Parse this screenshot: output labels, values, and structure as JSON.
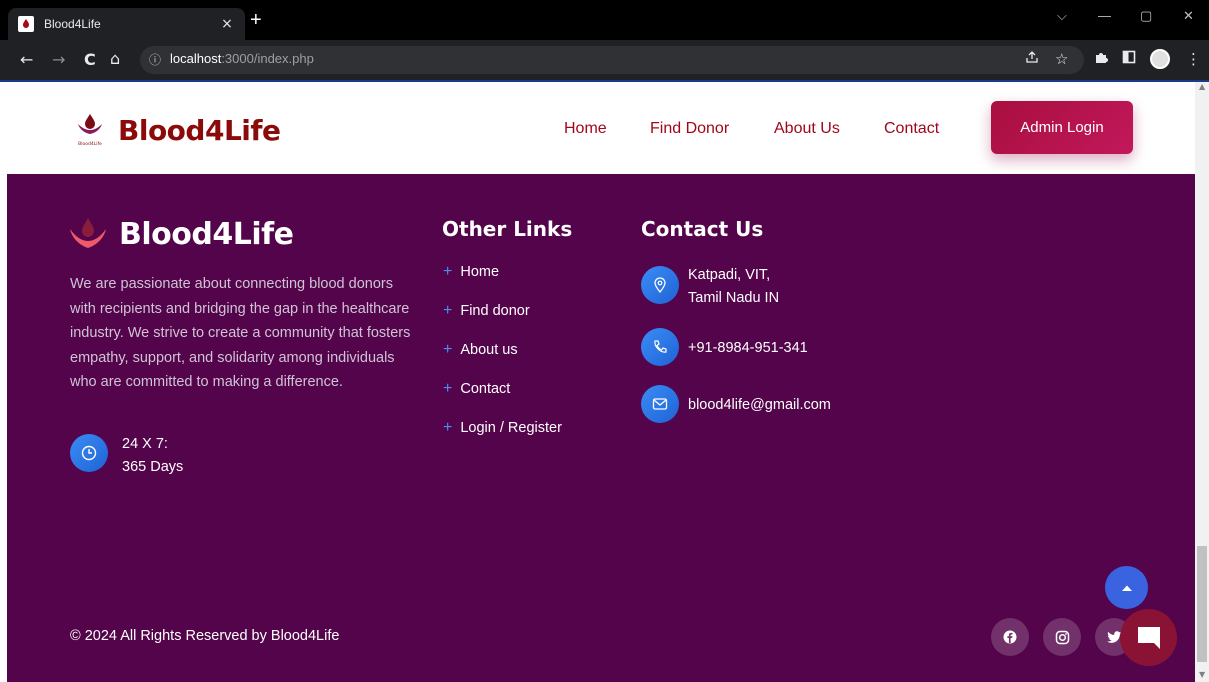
{
  "browser": {
    "tab_title": "Blood4Life",
    "tab_close": "×",
    "new_tab": "+",
    "url_host": "localhost",
    "url_rest": ":3000/index.php",
    "nav_back": "←",
    "nav_forward": "→",
    "nav_reload": "C",
    "nav_home": "⌂",
    "info_icon": "ⓘ",
    "win_dropdown": "⌵",
    "win_minimize": "—",
    "win_restore": "▢",
    "win_close": "✕"
  },
  "header": {
    "brand": "Blood4Life",
    "logo_small_text": "Blood4Life",
    "nav": [
      "Home",
      "Find Donor",
      "About Us",
      "Contact"
    ],
    "admin_login": "Admin Login"
  },
  "footer": {
    "brand": "Blood4Life",
    "about": "We are passionate about connecting blood donors with recipients and bridging the gap in the healthcare industry. We strive to create a community that fosters empathy, support, and solidarity among individuals who are committed to making a difference.",
    "hours_line1": "24 X 7:",
    "hours_line2": "365 Days",
    "other_links_title": "Other Links",
    "other_links": [
      "Home",
      "Find donor",
      "About us",
      "Contact",
      "Login / Register"
    ],
    "plus": "+",
    "contact_title": "Contact Us",
    "address_line1": "Katpadi, VIT,",
    "address_line2": "Tamil Nadu IN",
    "phone": "+91-8984-951-341",
    "email": "blood4life@gmail.com",
    "copyright": "© 2024 All Rights Reserved by Blood4Life"
  },
  "icons": {
    "clock": "clock-icon",
    "location": "location-pin-icon",
    "phone": "phone-icon",
    "email": "mail-icon",
    "facebook": "facebook-icon",
    "instagram": "instagram-icon",
    "twitter": "twitter-icon",
    "back_to_top": "arrow-up-icon",
    "chat": "chat-icon"
  },
  "colors": {
    "brand_red": "#8b0a0a",
    "nav_red": "#a0071c",
    "admin_button": "#c2185b",
    "footer_bg": "#54044a",
    "icon_blue": "#1e63d6",
    "back_to_top_blue": "#3a63e0",
    "chat_button": "#8a1234"
  }
}
